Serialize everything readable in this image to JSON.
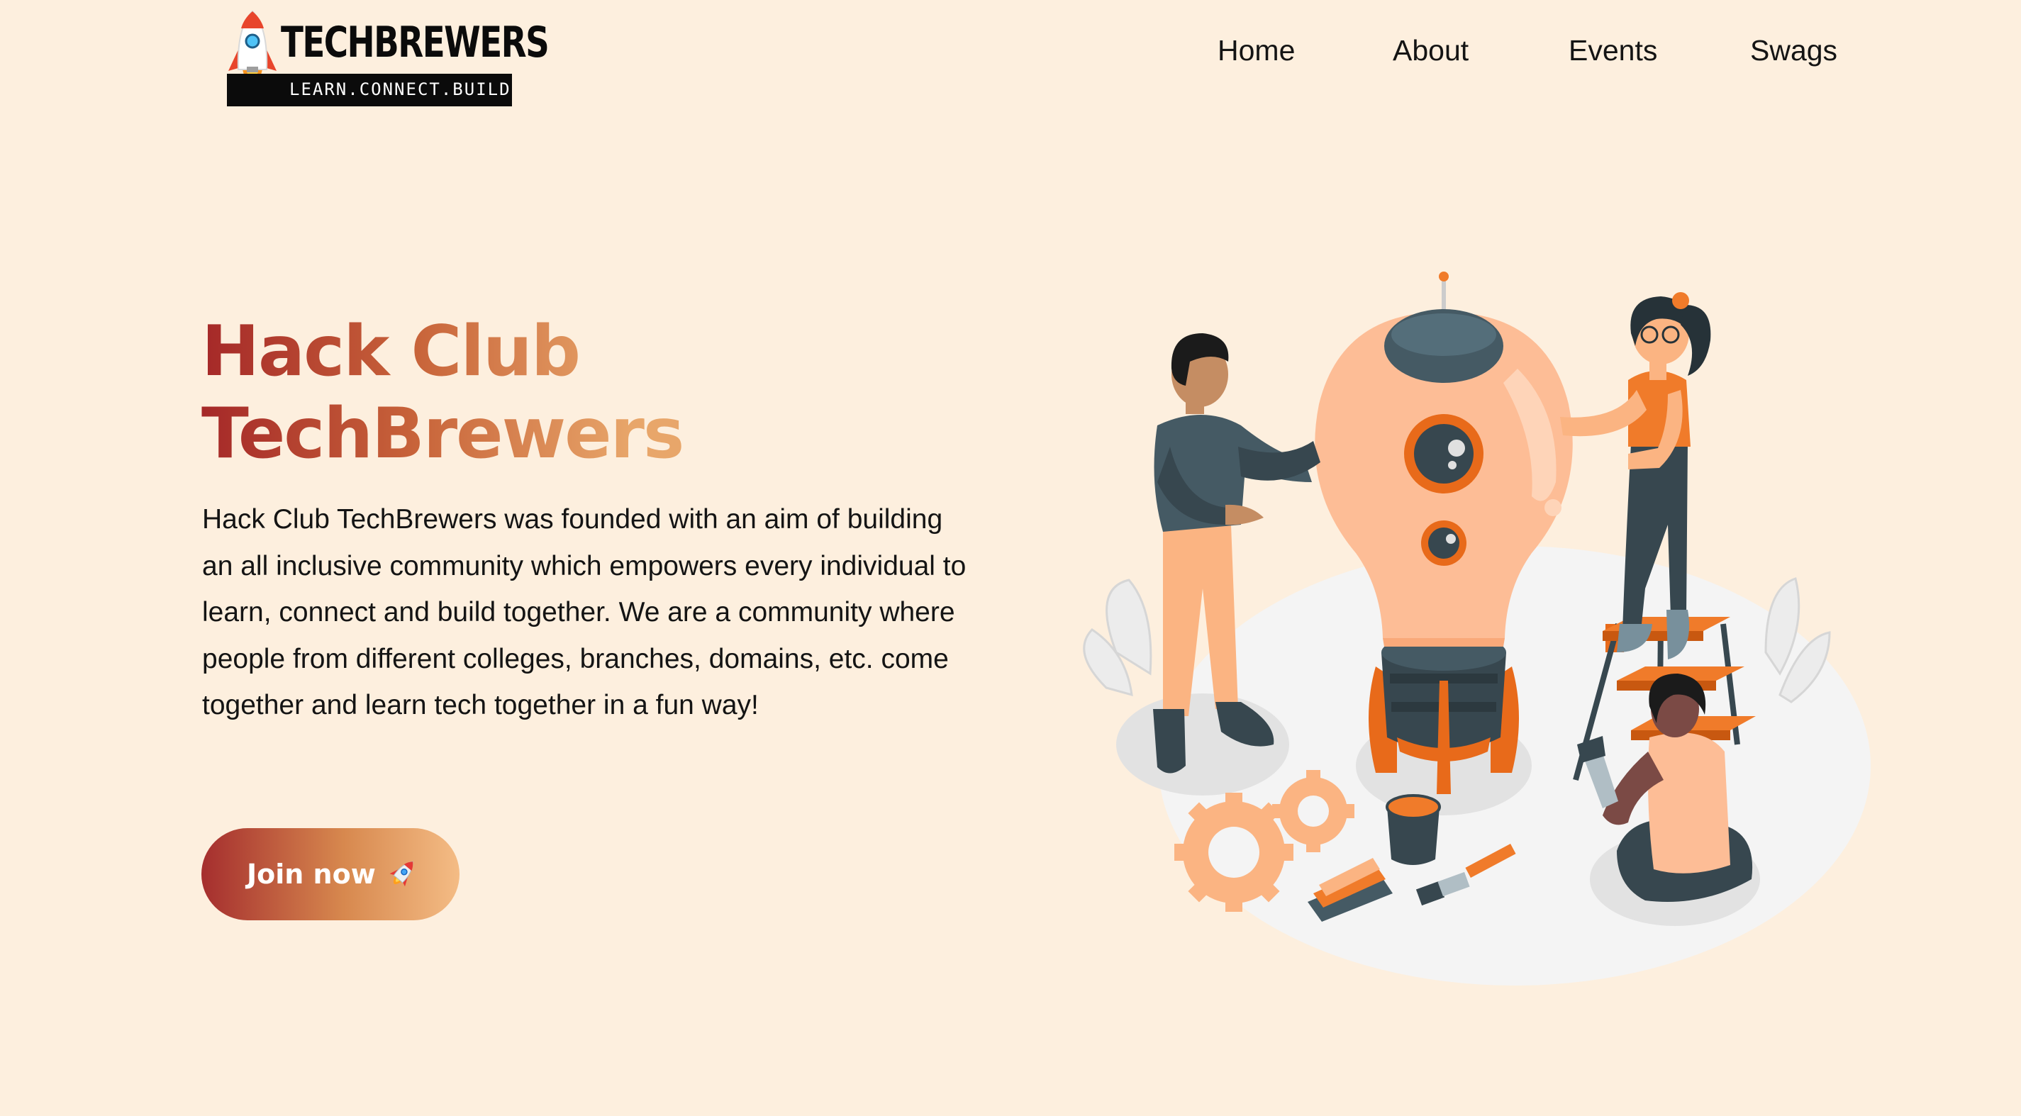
{
  "header": {
    "logo": {
      "title": "TECHBREWERS",
      "tagline": "LEARN.CONNECT.BUILD",
      "icon": "rocket-icon"
    },
    "nav": [
      {
        "label": "Home"
      },
      {
        "label": "About"
      },
      {
        "label": "Events"
      },
      {
        "label": "Swags"
      }
    ]
  },
  "hero": {
    "title_line1_a": "Hack",
    "title_line1_b": "Club",
    "title_line2": "TechBrewers",
    "description": "Hack Club TechBrewers was founded with an aim of building an all inclusive community which empowers every individual to learn, connect and build together. We are a community where people from different colleges, branches, domains, etc. come together and learn tech together in a fun way!",
    "join_button": "Join now",
    "join_icon": "rocket-emoji-icon"
  },
  "illustration": {
    "icon": "team-building-rocket-illustration"
  },
  "colors": {
    "background": "#fdefde",
    "gradient_start": "#a52828",
    "gradient_end": "#f4bc85",
    "accent_orange": "#f07b2a",
    "text": "#141414"
  }
}
